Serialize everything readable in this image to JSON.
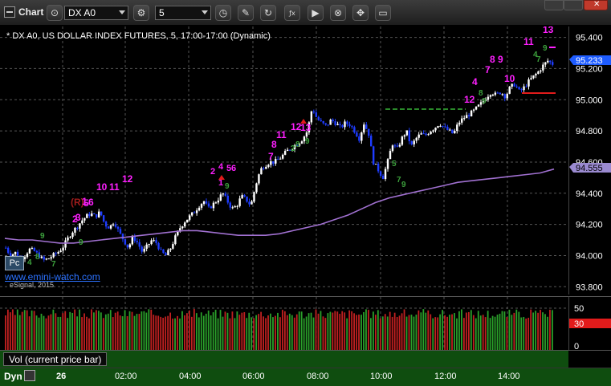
{
  "toolbar": {
    "app_title": "Chart",
    "symbol": "DX A0",
    "interval": "5"
  },
  "chart": {
    "title": "* DX A0, US DOLLAR INDEX FUTURES, 5, 17:00-17:00 (Dynamic)",
    "watermark": "eSignal, 2015",
    "brand_link": "www.emini-watch.com",
    "pc_badge": "Pc",
    "last_price": "95.233",
    "ma_price": "94.555",
    "colors": {
      "up_candle": "#ffffff",
      "down_candle": "#1e3cff",
      "ma_line": "#a070d0",
      "setup_count": "#ff20ff",
      "countdown": "#3ca03c",
      "price_tag": "#1e5cff",
      "ma_tag": "#9a8ad0"
    }
  },
  "price_axis": {
    "labels": [
      "95.400",
      "95.200",
      "95.000",
      "94.800",
      "94.600",
      "94.400",
      "94.200",
      "94.000",
      "93.800"
    ]
  },
  "volume": {
    "caption": "Vol (current price bar)",
    "labels": [
      "50",
      "30",
      "0"
    ],
    "current_value": "30"
  },
  "time_axis": {
    "dyn_label": "Dyn",
    "labels": [
      "26",
      "02:00",
      "04:00",
      "06:00",
      "08:00",
      "10:00",
      "12:00",
      "14:00"
    ]
  },
  "chart_data": {
    "type": "candlestick",
    "title": "* DX A0, US DOLLAR INDEX FUTURES, 5, 17:00-17:00 (Dynamic)",
    "ylim": [
      93.75,
      95.47
    ],
    "x_ticks": [
      "26",
      "02:00",
      "04:00",
      "06:00",
      "08:00",
      "10:00",
      "12:00",
      "14:00"
    ],
    "y_ticks": [
      93.8,
      94.0,
      94.2,
      94.4,
      94.6,
      94.8,
      95.0,
      95.2,
      95.4
    ],
    "close_path": [
      94.05,
      94.0,
      94.02,
      93.98,
      94.0,
      94.04,
      94.03,
      94.0,
      93.97,
      93.98,
      94.0,
      94.02,
      94.05,
      94.1,
      94.15,
      94.18,
      94.22,
      94.25,
      94.27,
      94.25,
      94.28,
      94.2,
      94.18,
      94.22,
      94.15,
      94.1,
      94.05,
      94.12,
      94.08,
      94.02,
      94.06,
      94.1,
      94.08,
      94.02,
      94.0,
      94.05,
      94.12,
      94.18,
      94.22,
      94.25,
      94.28,
      94.32,
      94.35,
      94.3,
      94.33,
      94.36,
      94.4,
      94.35,
      94.3,
      94.32,
      94.38,
      94.36,
      94.32,
      94.45,
      94.55,
      94.58,
      94.6,
      94.6,
      94.62,
      94.65,
      94.68,
      94.7,
      94.72,
      94.75,
      94.8,
      94.95,
      94.88,
      94.85,
      94.83,
      94.87,
      94.85,
      94.82,
      94.85,
      94.84,
      94.8,
      94.75,
      94.85,
      94.78,
      94.6,
      94.55,
      94.5,
      94.6,
      94.72,
      94.68,
      94.75,
      94.8,
      94.7,
      94.75,
      94.78,
      94.77,
      94.8,
      94.82,
      94.85,
      94.82,
      94.8,
      94.78,
      94.85,
      94.88,
      94.9,
      94.92,
      94.95,
      94.98,
      95.02,
      95.05,
      95.03,
      95.05,
      95.02,
      95.08,
      95.1,
      95.05,
      95.08,
      95.12,
      95.15,
      95.18,
      95.22,
      95.25,
      95.23
    ],
    "ma_path": [
      94.11,
      94.1,
      94.1,
      94.09,
      94.08,
      94.08,
      94.09,
      94.1,
      94.11,
      94.12,
      94.13,
      94.14,
      94.15,
      94.16,
      94.16,
      94.15,
      94.14,
      94.13,
      94.13,
      94.13,
      94.14,
      94.16,
      94.18,
      94.2,
      94.23,
      94.26,
      94.3,
      94.34,
      94.37,
      94.39,
      94.41,
      94.43,
      94.45,
      94.47,
      94.48,
      94.49,
      94.5,
      94.51,
      94.52,
      94.53,
      94.555
    ],
    "annotations": {
      "setup_counts": [
        "1",
        "2",
        "3",
        "4",
        "5",
        "6",
        "7",
        "8",
        "9",
        "10",
        "11",
        "12",
        "13",
        "(R)"
      ],
      "countdowns": [
        "1",
        "2",
        "3",
        "4",
        "5",
        "6",
        "7",
        "8",
        "9"
      ]
    }
  }
}
